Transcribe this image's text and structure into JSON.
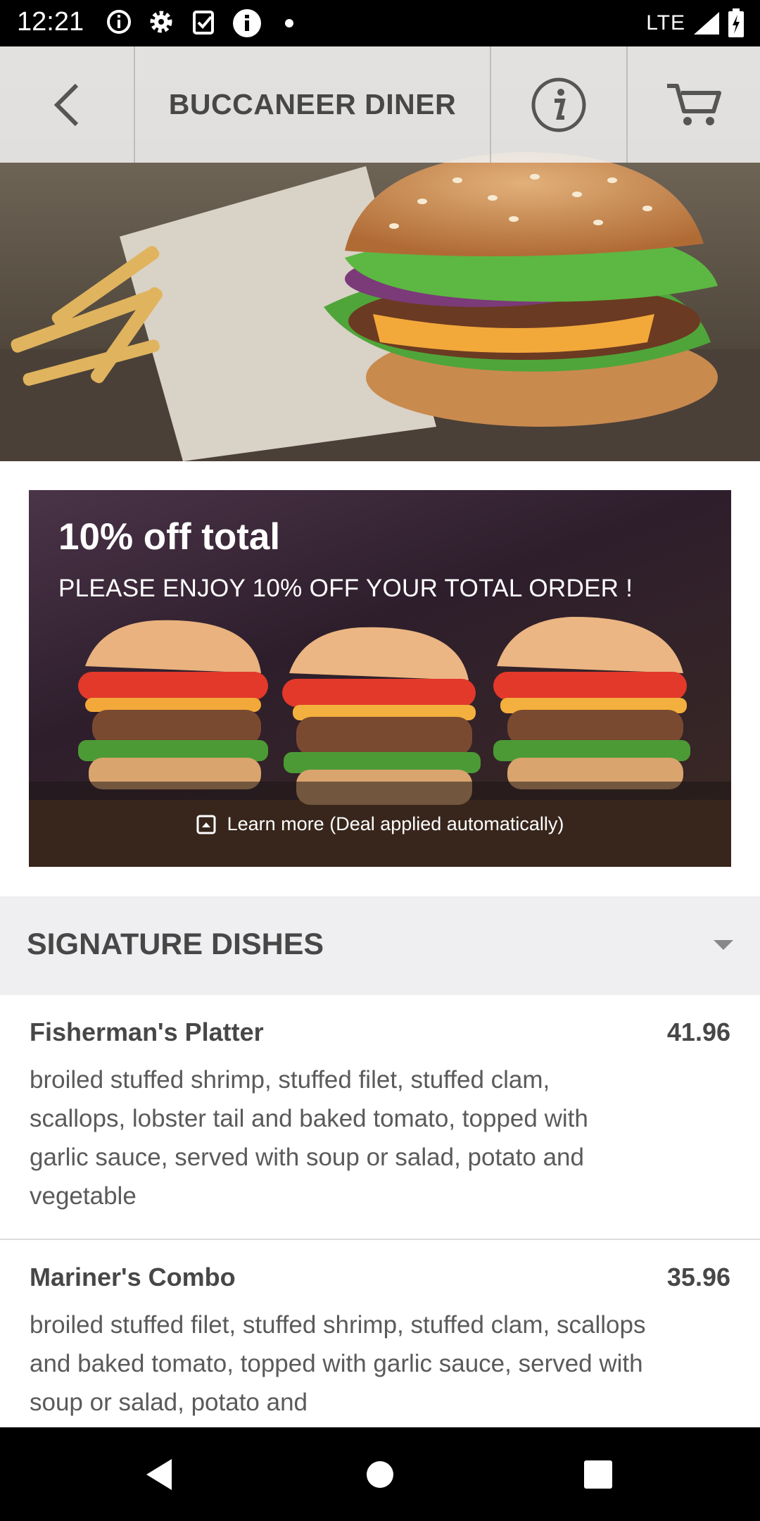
{
  "status_bar": {
    "time": "12:21",
    "network": "LTE",
    "icons": [
      "info-circle-icon",
      "gear-icon",
      "clipboard-check-icon",
      "info-filled-icon",
      "dot-icon",
      "signal-icon",
      "battery-icon"
    ]
  },
  "header": {
    "title": "BUCCANEER DINER",
    "back_icon": "chevron-left-icon",
    "info_icon": "info-icon",
    "cart_icon": "cart-icon"
  },
  "deal": {
    "title": "10% off total",
    "subtitle": "PLEASE ENJOY 10% OFF YOUR TOTAL ORDER !",
    "footer_text": "Learn more (Deal applied automatically)"
  },
  "section": {
    "title": "SIGNATURE DISHES"
  },
  "menu_items": [
    {
      "name": "Fisherman's Platter",
      "price": "41.96",
      "description": "broiled stuffed shrimp, stuffed filet, stuffed clam, scallops, lobster tail and baked tomato, topped with garlic sauce, served with soup or salad, potato and vegetable"
    },
    {
      "name": "Mariner's Combo",
      "price": "35.96",
      "description": "broiled stuffed filet, stuffed shrimp, stuffed clam, scallops and baked tomato, topped with garlic sauce, served with soup or salad, potato and"
    }
  ],
  "colors": {
    "header_bg": "#f0f0f0",
    "text_dark": "#474747",
    "section_bg": "#efeef0"
  }
}
